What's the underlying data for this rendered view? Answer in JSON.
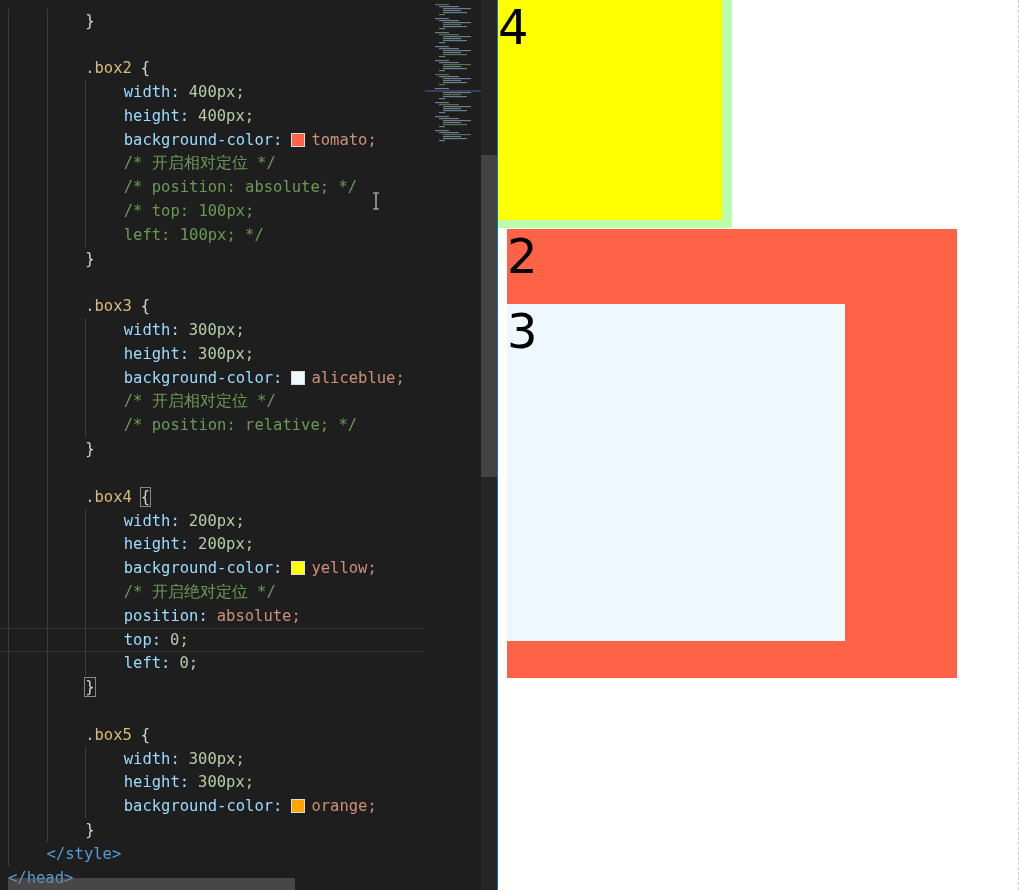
{
  "editor": {
    "code": {
      "rules": [
        {
          "bracket_match": false,
          "close": "}"
        },
        {
          "selector": ".box2",
          "open": "{",
          "bracket_match": false,
          "items": [
            {
              "kind": "number",
              "property": "width:",
              "value": "400px;",
              "current_line": false
            },
            {
              "kind": "number",
              "property": "height:",
              "value": "400px;",
              "current_line": false
            },
            {
              "kind": "keyword",
              "property": "background-color:",
              "color": "#ff6347",
              "value": "tomato;",
              "current_line": false
            },
            {
              "kind": "comment",
              "text": "/* 开启相对定位 */",
              "current_line": false
            },
            {
              "kind": "comment",
              "text": "/* position: absolute; */",
              "current_line": false
            },
            {
              "kind": "comment",
              "text": "/* top: 100px;",
              "current_line": false
            },
            {
              "kind": "comment",
              "text": "left: 100px; */",
              "current_line": false
            }
          ],
          "close": "}"
        },
        {
          "selector": ".box3",
          "open": "{",
          "bracket_match": false,
          "items": [
            {
              "kind": "number",
              "property": "width:",
              "value": "300px;",
              "current_line": false
            },
            {
              "kind": "number",
              "property": "height:",
              "value": "300px;",
              "current_line": false
            },
            {
              "kind": "keyword",
              "property": "background-color:",
              "color": "#f0f8ff",
              "value": "aliceblue;",
              "current_line": false
            },
            {
              "kind": "comment",
              "text": "/* 开启相对定位 */",
              "current_line": false
            },
            {
              "kind": "comment",
              "text": "/* position: relative; */",
              "current_line": false
            }
          ],
          "close": "}"
        },
        {
          "selector": ".box4",
          "open": "{",
          "bracket_match": true,
          "items": [
            {
              "kind": "number",
              "property": "width:",
              "value": "200px;",
              "current_line": false
            },
            {
              "kind": "number",
              "property": "height:",
              "value": "200px;",
              "current_line": false
            },
            {
              "kind": "keyword",
              "property": "background-color:",
              "color": "#ffff00",
              "value": "yellow;",
              "current_line": false
            },
            {
              "kind": "comment",
              "text": "/* 开启绝对定位 */",
              "current_line": false
            },
            {
              "kind": "keyword",
              "property": "position:",
              "value": "absolute;",
              "current_line": false
            },
            {
              "kind": "number",
              "property": "top:",
              "value": "0;",
              "current_line": true
            },
            {
              "kind": "number",
              "property": "left:",
              "value": "0;",
              "current_line": false
            }
          ],
          "close": "}"
        },
        {
          "selector": ".box5",
          "open": "{",
          "bracket_match": false,
          "items": [
            {
              "kind": "number",
              "property": "width:",
              "value": "300px;",
              "current_line": false
            },
            {
              "kind": "number",
              "property": "height:",
              "value": "300px;",
              "current_line": false
            },
            {
              "kind": "keyword",
              "property": "background-color:",
              "color": "#ffa500",
              "value": "orange;",
              "current_line": false
            }
          ],
          "close": "}"
        }
      ],
      "style_close": "</style>",
      "head_close": "</head>"
    }
  },
  "preview": {
    "boxes": [
      {
        "color": "#bbffaa",
        "children": [
          {
            "color": "#ffff00",
            "label": "4"
          }
        ]
      },
      {
        "color": "#ff6347",
        "label": "2",
        "children": [
          {
            "color": "#f0f8ff",
            "label": "3"
          }
        ]
      }
    ]
  }
}
